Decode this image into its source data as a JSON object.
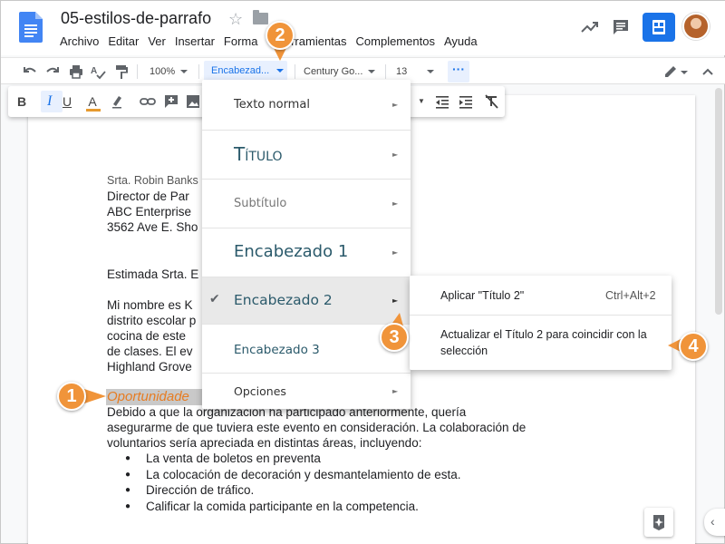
{
  "doc": {
    "title": "05-estilos-de-parrafo"
  },
  "menubar": [
    "Archivo",
    "Editar",
    "Ver",
    "Insertar",
    "Forma",
    "Herramientas",
    "Complementos",
    "Ayuda"
  ],
  "toolbar": {
    "zoom": "100%",
    "style": "Encabezad...",
    "font": "Century Go...",
    "font_size": "13",
    "more": "···"
  },
  "style_menu": {
    "items": [
      {
        "label": "Texto normal"
      },
      {
        "label": "Título"
      },
      {
        "label": "Subtítulo"
      },
      {
        "label": "Encabezado 1"
      },
      {
        "label": "Encabezado 2",
        "checked": true
      },
      {
        "label": "Encabezado 3"
      },
      {
        "label": "Opciones"
      }
    ],
    "checkmark": "✔",
    "submenu_arrow": "►"
  },
  "submenu": {
    "apply_label": "Aplicar \"Título 2\"",
    "apply_shortcut": "Ctrl+Alt+2",
    "update_label_line1": "Actualizar el Título 2 para coincidir con la",
    "update_label_line2": "selección"
  },
  "letter": {
    "recipient_name": "Srta. Robin Banks",
    "recipient_title": "Director de Par",
    "company": "ABC Enterprise",
    "address": "3562 Ave E. Sho",
    "greeting": "Estimada Srta. E",
    "para1": [
      "Mi nombre es K",
      "distrito escolar p",
      "cocina de este",
      "de clases. El ev",
      "Highland Grove"
    ],
    "heading": "Oportunidade",
    "para2": [
      "Debido a que la organización ha participado anteriormente, quería",
      "asegurarme de que tuviera este evento en consideración. La colaboración de",
      "voluntarios sería apreciada en distintas áreas, incluyendo:"
    ],
    "bullets": [
      "La venta de boletos en preventa",
      "La colocación de decoración y desmantelamiento de esta.",
      "Dirección de tráfico.",
      "Calificar la comida participante en la competencia."
    ]
  },
  "callouts": [
    "1",
    "2",
    "3",
    "4"
  ],
  "colors": {
    "accent": "#1a73e8",
    "callout": "#f0943a",
    "heading_orange": "#e67c22",
    "heading_teal": "#2b5a6b"
  }
}
